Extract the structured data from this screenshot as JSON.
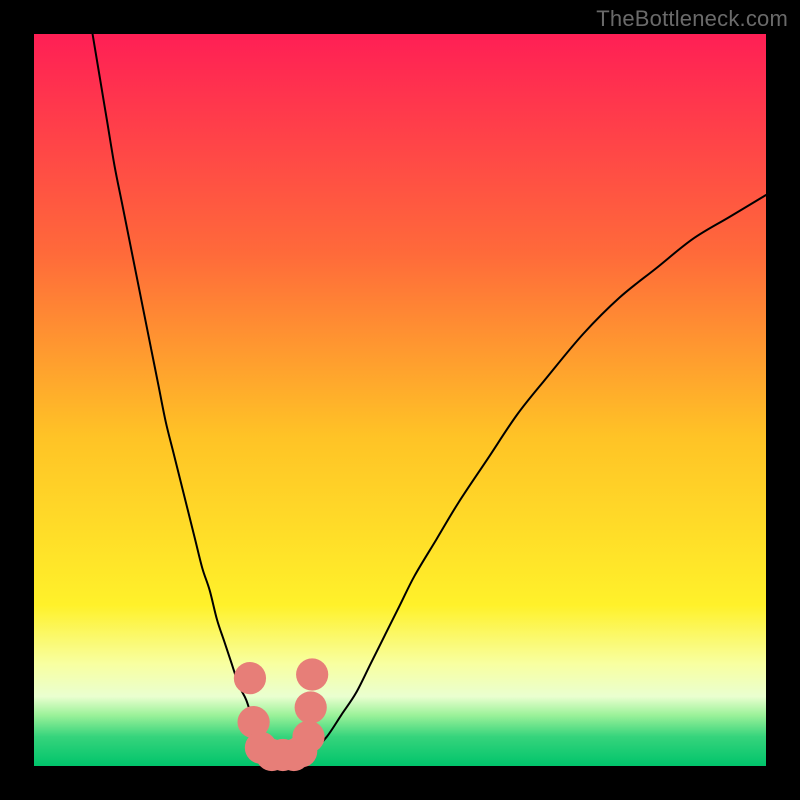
{
  "watermark": "TheBottleneck.com",
  "colors": {
    "frame": "#000000",
    "curve": "#000000",
    "marker": "#e77e78",
    "watermark": "#6a6a6a"
  },
  "chart_data": {
    "type": "line",
    "title": "",
    "xlabel": "",
    "ylabel": "",
    "xlim": [
      0,
      100
    ],
    "ylim": [
      0,
      100
    ],
    "gradient": [
      {
        "stop": 0,
        "color": "#ff1f55"
      },
      {
        "stop": 0.3,
        "color": "#ff6a3a"
      },
      {
        "stop": 0.55,
        "color": "#ffc326"
      },
      {
        "stop": 0.78,
        "color": "#fff12a"
      },
      {
        "stop": 0.86,
        "color": "#f8ffa0"
      },
      {
        "stop": 0.905,
        "color": "#eaffd0"
      },
      {
        "stop": 0.93,
        "color": "#9df29a"
      },
      {
        "stop": 0.96,
        "color": "#36d47c"
      },
      {
        "stop": 1.0,
        "color": "#00c46b"
      }
    ],
    "series": [
      {
        "name": "bottleneck-curve",
        "x": [
          8,
          9,
          10,
          11,
          12,
          13,
          14,
          15,
          16,
          17,
          18,
          19,
          20,
          21,
          22,
          23,
          24,
          25,
          26,
          27,
          28,
          29,
          30,
          31,
          32,
          33,
          34,
          35,
          36,
          37,
          38,
          40,
          42,
          44,
          46,
          48,
          50,
          52,
          55,
          58,
          62,
          66,
          70,
          75,
          80,
          85,
          90,
          95,
          100
        ],
        "y": [
          100,
          94,
          88,
          82,
          77,
          72,
          67,
          62,
          57,
          52,
          47,
          43,
          39,
          35,
          31,
          27,
          24,
          20,
          17,
          14,
          11,
          9,
          6,
          4,
          3,
          2,
          1.5,
          1,
          1,
          1.5,
          2,
          4,
          7,
          10,
          14,
          18,
          22,
          26,
          31,
          36,
          42,
          48,
          53,
          59,
          64,
          68,
          72,
          75,
          78
        ]
      }
    ],
    "markers": {
      "name": "bottleneck-points",
      "x": [
        29.5,
        30.0,
        31.0,
        32.5,
        34.0,
        35.5,
        36.5,
        37.5,
        37.8,
        38.0
      ],
      "y": [
        12.0,
        6.0,
        2.5,
        1.5,
        1.5,
        1.5,
        2.0,
        4.0,
        8.0,
        12.5
      ],
      "r": 2.2
    }
  }
}
